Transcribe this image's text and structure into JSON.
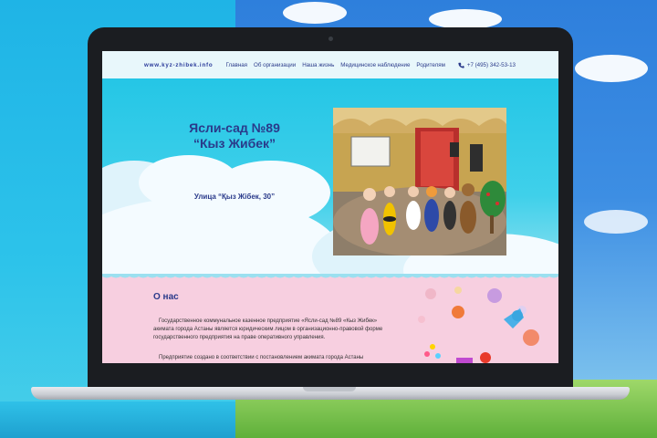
{
  "site": {
    "logo": "www.kyz-zhibek.info",
    "menu": [
      "Главная",
      "Об организации",
      "Наша жизнь",
      "Медицинское наблюдение",
      "Родителям"
    ],
    "phone": "+7 (495) 342-53-13",
    "icons": {
      "phone": "phone-icon"
    }
  },
  "hero": {
    "title_line1": "Ясли-сад №89",
    "title_line2": "“Кыз Жибек”",
    "address": "Улица “Қыз Жібек, 30”"
  },
  "about": {
    "title": "О нас",
    "paragraph1": "Государственное коммунальное казенное предприятие «Ясли-сад №89 «Кыз Жибек» акимата города Астаны является юридическим лицом в организационно-правовой форме государственного предприятия на праве оперативного управления.",
    "paragraph2": "Предприятие создано в соответствии с постановлением акимата города Астаны"
  },
  "colors": {
    "brand": "#2a3a8a",
    "hero": "#25c6e6",
    "about_bg": "#f7cfe0"
  }
}
